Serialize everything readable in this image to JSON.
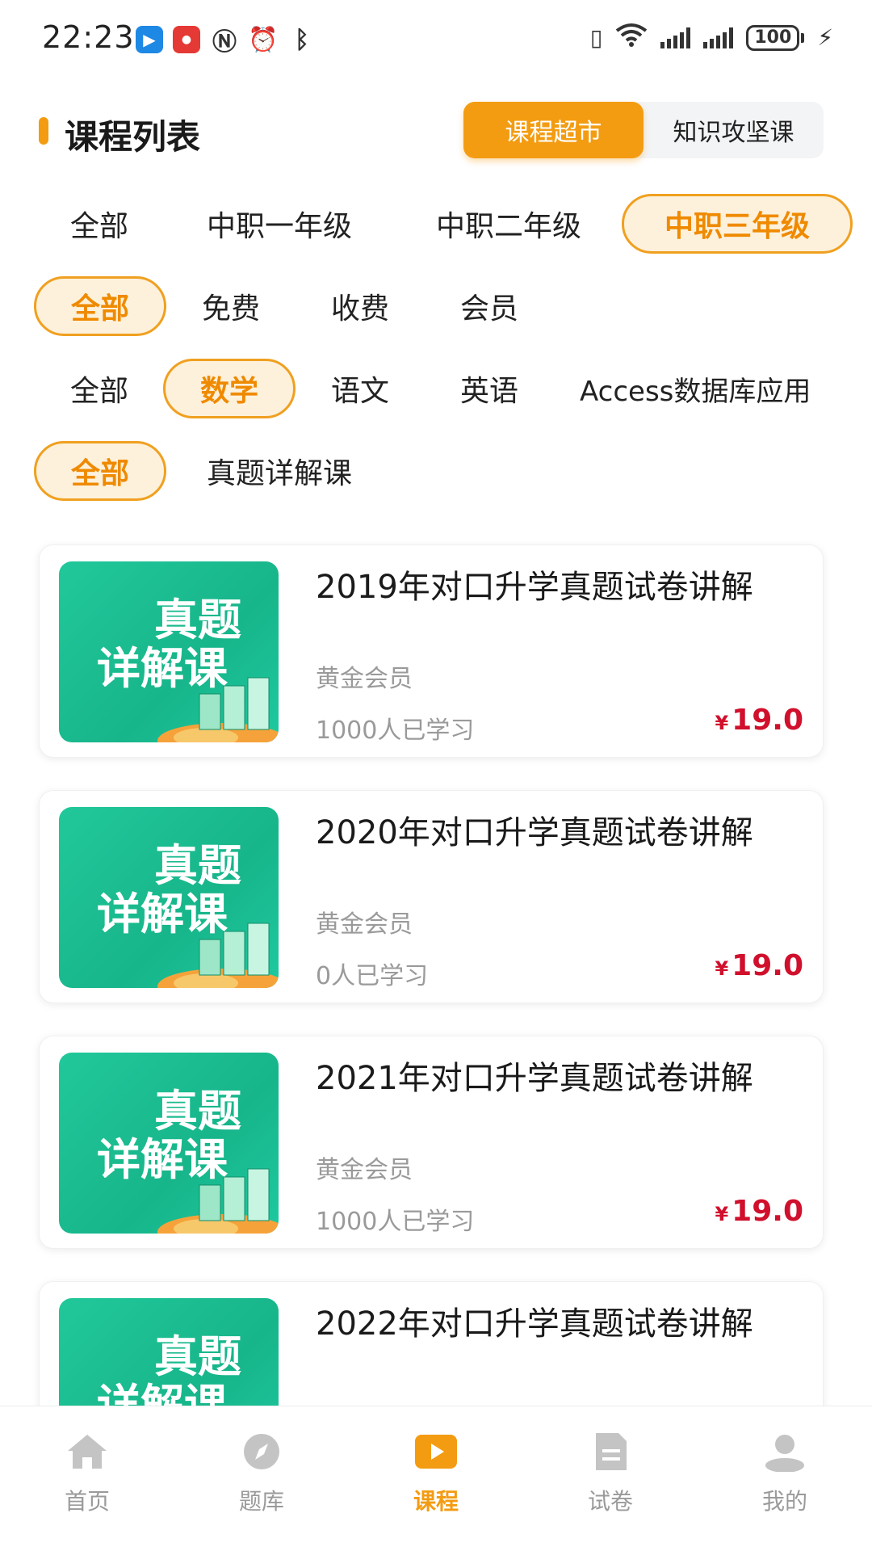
{
  "status_bar": {
    "time": "22:23",
    "battery": "100",
    "signal_label": "6"
  },
  "header": {
    "title": "课程列表",
    "segments": [
      "课程超市",
      "知识攻坚课"
    ],
    "active_segment": "课程超市"
  },
  "filters": {
    "grade": {
      "items": [
        "全部",
        "中职一年级",
        "中职二年级",
        "中职三年级"
      ],
      "selected": "中职三年级"
    },
    "price": {
      "items": [
        "全部",
        "免费",
        "收费",
        "会员"
      ],
      "selected": "全部"
    },
    "subject": {
      "items": [
        "全部",
        "数学",
        "语文",
        "英语",
        "Access数据库应用"
      ],
      "selected": "数学"
    },
    "type": {
      "items": [
        "全部",
        "真题详解课"
      ],
      "selected": "全部"
    }
  },
  "courses": [
    {
      "thumb_line1": "真题",
      "thumb_line2": "详解课",
      "title": "2019年对口升学真题试卷讲解",
      "level": "黄金会员",
      "learners": "1000人已学习",
      "currency": "¥",
      "price": "19.0"
    },
    {
      "thumb_line1": "真题",
      "thumb_line2": "详解课",
      "title": "2020年对口升学真题试卷讲解",
      "level": "黄金会员",
      "learners": "0人已学习",
      "currency": "¥",
      "price": "19.0"
    },
    {
      "thumb_line1": "真题",
      "thumb_line2": "详解课",
      "title": "2021年对口升学真题试卷讲解",
      "level": "黄金会员",
      "learners": "1000人已学习",
      "currency": "¥",
      "price": "19.0"
    },
    {
      "thumb_line1": "真题",
      "thumb_line2": "详解课",
      "title": "2022年对口升学真题试卷讲解",
      "level": "",
      "learners": "",
      "currency": "",
      "price": ""
    }
  ],
  "tabbar": {
    "items": [
      {
        "label": "首页",
        "icon": "home-icon"
      },
      {
        "label": "题库",
        "icon": "compass-icon"
      },
      {
        "label": "课程",
        "icon": "play-icon"
      },
      {
        "label": "试卷",
        "icon": "document-icon"
      },
      {
        "label": "我的",
        "icon": "user-icon"
      }
    ],
    "active": "课程"
  },
  "colors": {
    "accent": "#f39c12",
    "price": "#d0102c",
    "thumb": "#1fc49a"
  }
}
